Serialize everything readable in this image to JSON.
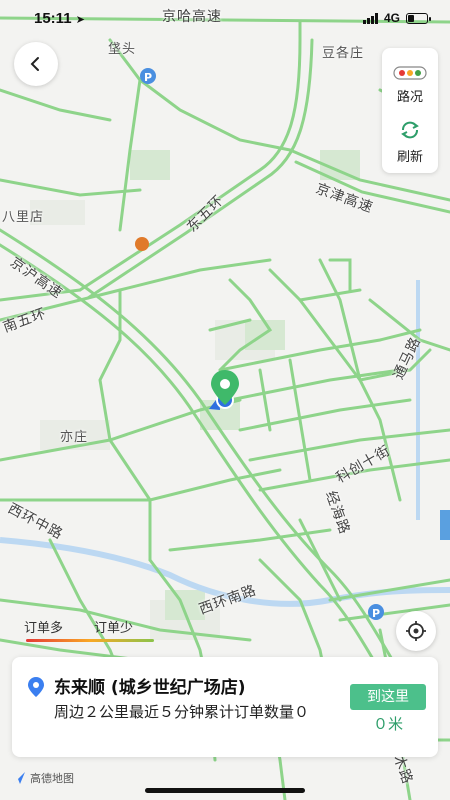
{
  "status_bar": {
    "time": "15:11",
    "network": "4G"
  },
  "map": {
    "labels": {
      "jingha": "京哈高速",
      "baotou": "垡头",
      "dougezhuang": "豆各庄",
      "jingjin": "京津高速",
      "balidian": "八里店",
      "dongwuhuan": "东五环",
      "jinghu": "京沪高速",
      "nanwuhuan": "南五环",
      "tongmalu": "通马路",
      "kechuang": "科创十街",
      "yizhuang": "亦庄",
      "jingbo": "经海路",
      "xihuanzhong": "西环中路",
      "xihuannan": "西环南路",
      "bottom_road": "木路"
    }
  },
  "controls": {
    "traffic_label": "路况",
    "refresh_label": "刷新"
  },
  "legend": {
    "more": "订单多",
    "less": "订单少"
  },
  "store_card": {
    "name": "东来顺 (城乡世纪广场店)",
    "description": "周边２公里最近５分钟累计订单数量０",
    "go_button": "到这里",
    "distance": "０米"
  },
  "footer": {
    "logo_text": "高德地图"
  },
  "colors": {
    "road": "#8ed48a",
    "accent": "#4cc08b",
    "pin": "#3fb96a",
    "location": "#2f6fe0"
  }
}
